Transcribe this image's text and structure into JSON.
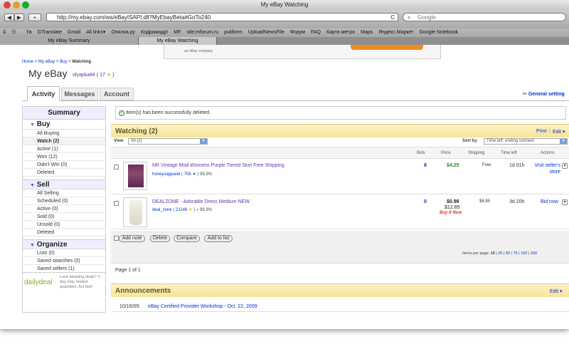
{
  "window": {
    "title": "My eBay Watching"
  },
  "toolbar": {
    "back": "◀",
    "forward": "▶",
    "add": "+",
    "url": "http://my.ebay.com/ws/eBayISAPI.dll?MyEbayBeta#GoTo240",
    "reload": "C",
    "search_placeholder": "Google"
  },
  "bookmarks": [
    "Ya",
    "GTranslate",
    "Gmail",
    "All links▾",
    "Опилка.ру",
    "Кодражадр!",
    "MF",
    "site:mforum.ru",
    "pubform",
    "UploadNewsFile",
    "Форум",
    "FAQ",
    "Карта метро",
    "Maps",
    "Яндекс.Маркет",
    "Google Notebook"
  ],
  "tabs": [
    "My eBay Summary",
    "My eBay Watching"
  ],
  "ad": {
    "text": "an eBay company"
  },
  "breadcrumb": {
    "home": "Home",
    "sep": ">",
    "myebay": "My eBay",
    "buy": "Buy",
    "current": "Watching"
  },
  "page_title": {
    "title": "My eBay",
    "user": "olyapka84",
    "score": "17"
  },
  "main_tabs": {
    "activity": "Activity",
    "messages": "Messages",
    "account": "Account"
  },
  "general_settings": "General setting",
  "sidebar": {
    "summary": "Summary",
    "buy": {
      "title": "Buy",
      "items": [
        "All Buying",
        "Watch (2)",
        "Active (1)",
        "Won (12)",
        "Didn't Win (0)",
        "Deleted"
      ]
    },
    "sell": {
      "title": "Sell",
      "items": [
        "All Selling",
        "Scheduled (0)",
        "Active (0)",
        "Sold (0)",
        "Unsold (0)",
        "Deleted"
      ]
    },
    "organize": {
      "title": "Organize",
      "items": [
        "Lists (0)",
        "Saved searches (0)",
        "Saved sellers (1)"
      ]
    },
    "promo": {
      "brand": "dailydeal",
      "text": "Love amazing deals? 1-day only, limited quantities. Act fast!"
    }
  },
  "notice": "Item(s) has been successfully deleted.",
  "watching": {
    "title": "Watching (2)",
    "print": "Print",
    "edit": "Edit ▾",
    "view_label": "View",
    "view_value": "All (2)",
    "sort_label": "Sort by",
    "sort_value": "Time left: ending soonest",
    "headers": {
      "bids": "Bids",
      "price": "Price",
      "shipping": "Shipping",
      "time": "Time left",
      "actions": "Actions"
    },
    "items": [
      {
        "title": "NR Vintage Mod Womens Purple Tiered Skirt Free Shipping",
        "seller": "honeysapparel",
        "feedback": "706",
        "positive": "99.9%",
        "bids": "8",
        "price": "$4.25",
        "shipping": "Free",
        "time": "1d 01h",
        "action": "Visit seller's store"
      },
      {
        "title": "DEALZONE - Adorable Dress Medium NEW",
        "seller": "deal_zone",
        "feedback": "21146",
        "positive": "99.3%",
        "bids": "0",
        "price": "$0.98",
        "buy_price": "$12.85",
        "buy_label": "Buy It Now",
        "shipping": "$6.85",
        "time": "3d 20h",
        "action": "Bid now"
      }
    ],
    "buttons": {
      "add_note": "Add note",
      "delete": "Delete",
      "compare": "Compare",
      "add_to_list": "Add to list"
    },
    "per_page_label": "Items per page:",
    "per_page": [
      "10",
      "25",
      "50",
      "75",
      "100",
      "200"
    ],
    "page_info": "Page 1 of 1"
  },
  "announcements": {
    "title": "Announcements",
    "edit": "Edit ▾",
    "items": [
      {
        "date": "10/16/09:",
        "text": "eBay Certified Provider Workshop - Oct. 22, 2009"
      }
    ]
  }
}
